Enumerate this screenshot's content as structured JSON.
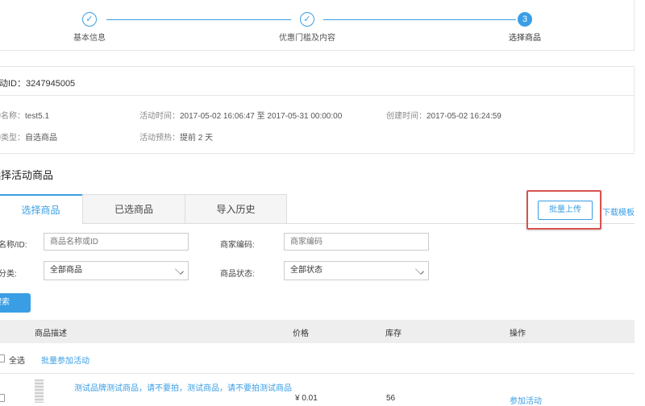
{
  "steps": [
    {
      "label": "基本信息",
      "state": "done"
    },
    {
      "label": "优惠门槛及内容",
      "state": "done"
    },
    {
      "label": "选择商品",
      "state": "current",
      "number": "3"
    }
  ],
  "check_glyph": "✓",
  "activity": {
    "id_label": "活动ID：",
    "id_value": "3247945005",
    "name_label": "活动名称：",
    "name_value": "test5.1",
    "time_label": "活动时间：",
    "time_value": "2017-05-02 16:06:47 至 2017-05-31 00:00:00",
    "created_label": "创建时间：",
    "created_value": "2017-05-02 16:24:59",
    "type_label": "活动类型：",
    "type_value": "自选商品",
    "preheat_label": "活动预热：",
    "preheat_value": "提前 2 天"
  },
  "section_title": "选择活动商品",
  "tabs": [
    "选择商品",
    "已选商品",
    "导入历史"
  ],
  "actions": {
    "batch_upload": "批量上传",
    "download_template": "下载模板"
  },
  "filters": {
    "name_label": "商品名称/ID:",
    "name_placeholder": "商品名称或ID",
    "code_label": "商家编码:",
    "code_placeholder": "商家编码",
    "category_label": "商品分类:",
    "category_value": "全部商品",
    "status_label": "商品状态:",
    "status_value": "全部状态",
    "search_button": "搜索"
  },
  "table": {
    "headers": {
      "desc": "商品描述",
      "price": "价格",
      "stock": "库存",
      "op": "操作"
    },
    "select_all": "全选",
    "batch_join": "批量参加活动",
    "rows": [
      {
        "title": "测试品牌测试商品，请不要拍，测试商品，请不要拍测试商品",
        "price": "¥ 0.01",
        "stock": "56",
        "action": "参加活动"
      }
    ]
  },
  "colors": {
    "accent": "#3a9ee4",
    "highlight": "#d9534f"
  }
}
